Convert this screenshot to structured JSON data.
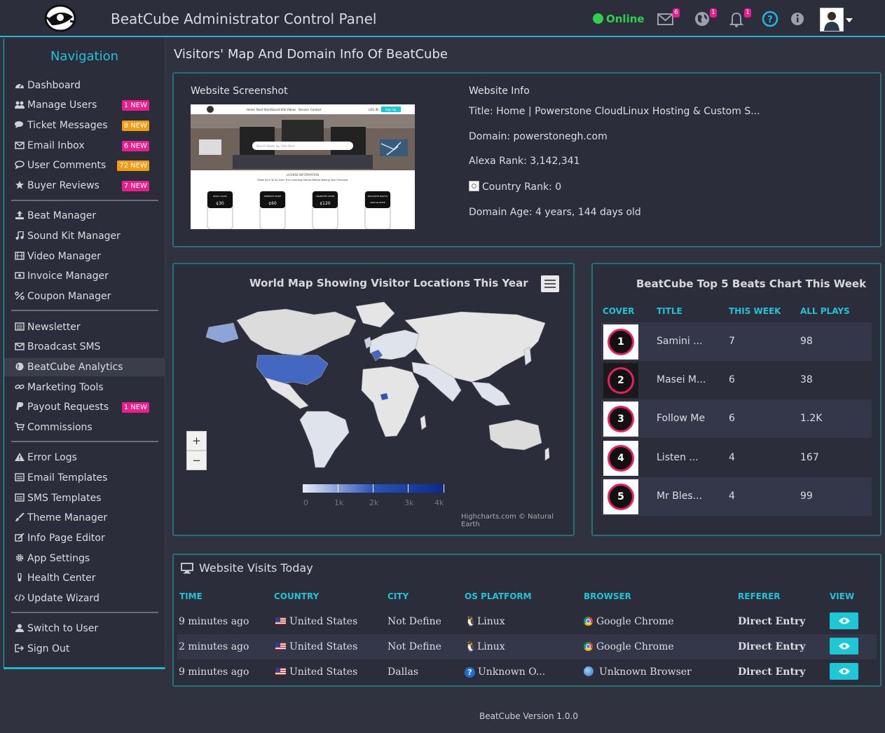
{
  "header": {
    "title": "BeatCube Administrator Control Panel",
    "status": "Online",
    "mail_badge": "6",
    "globe_badge": "1",
    "bell_badge": "1"
  },
  "sidebar": {
    "title": "Navigation",
    "items": [
      {
        "label": "Dashboard",
        "icon": "dashboard-icon"
      },
      {
        "label": "Manage Users",
        "icon": "users-icon",
        "badge": "1 NEW",
        "badge_color": "#e91e8c"
      },
      {
        "label": "Ticket Messages",
        "icon": "comments-icon",
        "badge": "8 NEW",
        "badge_color": "#f39c12"
      },
      {
        "label": "Email Inbox",
        "icon": "envelope-icon",
        "badge": "6 NEW",
        "badge_color": "#e91e8c"
      },
      {
        "label": "User Comments",
        "icon": "comment-icon",
        "badge": "72 NEW",
        "badge_color": "#f39c12"
      },
      {
        "label": "Buyer Reviews",
        "icon": "star-icon",
        "badge": "7 NEW",
        "badge_color": "#e91e8c"
      },
      {
        "label": "Beat Manager",
        "icon": "upload-icon"
      },
      {
        "label": "Sound Kit Manager",
        "icon": "music-icon"
      },
      {
        "label": "Video Manager",
        "icon": "film-icon"
      },
      {
        "label": "Invoice Manager",
        "icon": "money-icon"
      },
      {
        "label": "Coupon Manager",
        "icon": "percent-icon"
      },
      {
        "label": "Newsletter",
        "icon": "newspaper-icon"
      },
      {
        "label": "Broadcast SMS",
        "icon": "envelope-icon"
      },
      {
        "label": "BeatCube Analytics",
        "icon": "globe-icon"
      },
      {
        "label": "Marketing Tools",
        "icon": "link-icon"
      },
      {
        "label": "Payout Requests",
        "icon": "paypal-icon",
        "badge": "1 NEW",
        "badge_color": "#e91e8c"
      },
      {
        "label": "Commissions",
        "icon": "cart-icon"
      },
      {
        "label": "Error Logs",
        "icon": "warning-icon"
      },
      {
        "label": "Email Templates",
        "icon": "template-icon"
      },
      {
        "label": "SMS Templates",
        "icon": "template-icon"
      },
      {
        "label": "Theme Manager",
        "icon": "brush-icon"
      },
      {
        "label": "Info Page Editor",
        "icon": "edit-icon"
      },
      {
        "label": "App Settings",
        "icon": "gear-icon"
      },
      {
        "label": "Health Center",
        "icon": "thermometer-icon"
      },
      {
        "label": "Update Wizard",
        "icon": "code-icon"
      },
      {
        "label": "Switch to User",
        "icon": "user-icon"
      },
      {
        "label": "Sign Out",
        "icon": "sign-out-icon"
      }
    ]
  },
  "main": {
    "page_title": "Visitors' Map And Domain Info Of BeatCube",
    "website": {
      "screenshot_label": "Website Screenshot",
      "info_label": "Website Info",
      "title_line": "Title: Home | Powerstone CloudLinux Hosting & Custom S...",
      "domain_line": "Domain: powerstonegh.com",
      "alexa_line": "Alexa Rank: 3,142,341",
      "country_rank_line": "Country Rank: 0",
      "age_line": "Domain Age: 4 years, 144 days old",
      "shot": {
        "nav": [
          "Home",
          "Beat Store",
          "Sound Kits",
          "Videos",
          "Service",
          "Contact"
        ],
        "login": "LOG IN",
        "signup": "Sign Up",
        "search": "Search Beats eg. Vibe Beat",
        "section": "LICENSE INFORMATION",
        "subtitle": "Make Sure To Go Over The Licensing Details Before Making Your Purchase",
        "cards": [
          {
            "name": "BASIC LEASE",
            "price": "¢30"
          },
          {
            "name": "PREMIUM LEASE",
            "price": "¢60"
          },
          {
            "name": "UNLIMITED LEASE",
            "price": "¢120"
          },
          {
            "name": "EXCLUSIVE RIGHTS",
            "price": "MAKE AN OFFER"
          }
        ]
      }
    },
    "map": {
      "title": "World Map Showing Visitor Locations This Year",
      "zoom_in": "+",
      "zoom_out": "−",
      "legend_labels": [
        "0",
        "1k",
        "2k",
        "3k",
        "4k"
      ],
      "credits": "Highcharts.com © Natural Earth",
      "colors": {
        "low": "#e6ebf5",
        "high": "#2a54b8",
        "land": "#e5e5e5"
      }
    },
    "beats": {
      "title": "BeatCube Top 5 Beats Chart This Week",
      "headers": [
        "COVER",
        "TITLE",
        "THIS WEEK",
        "ALL PLAYS"
      ],
      "rows": [
        {
          "rank": "1",
          "title": "Samini ...",
          "week": "7",
          "plays": "98"
        },
        {
          "rank": "2",
          "title": "Masei M...",
          "week": "6",
          "plays": "38"
        },
        {
          "rank": "3",
          "title": "Follow Me",
          "week": "6",
          "plays": "1.2K"
        },
        {
          "rank": "4",
          "title": "Listen ...",
          "week": "4",
          "plays": "167"
        },
        {
          "rank": "5",
          "title": "Mr Bles...",
          "week": "4",
          "plays": "99"
        }
      ]
    },
    "visits": {
      "title": "Website Visits Today",
      "headers": [
        "TIME",
        "COUNTRY",
        "CITY",
        "OS PLATFORM",
        "BROWSER",
        "REFERER",
        "VIEW"
      ],
      "rows": [
        {
          "time": "9 minutes ago",
          "country": "United States",
          "city": "Not Define",
          "os": "Linux",
          "os_icon": "linux-icon",
          "browser": "Google Chrome",
          "browser_icon": "chrome-icon",
          "referer": "Direct Entry"
        },
        {
          "time": "2 minutes ago",
          "country": "United States",
          "city": "Not Define",
          "os": "Linux",
          "os_icon": "linux-icon",
          "browser": "Google Chrome",
          "browser_icon": "chrome-icon",
          "referer": "Direct Entry"
        },
        {
          "time": "9 minutes ago",
          "country": "United States",
          "city": "Dallas",
          "os": "Unknown O...",
          "os_icon": "question-icon",
          "browser": "Unknown Browser",
          "browser_icon": "globe-icon",
          "referer": "Direct Entry"
        }
      ]
    }
  },
  "footer": {
    "text": "BeatCube Version 1.0.0"
  }
}
